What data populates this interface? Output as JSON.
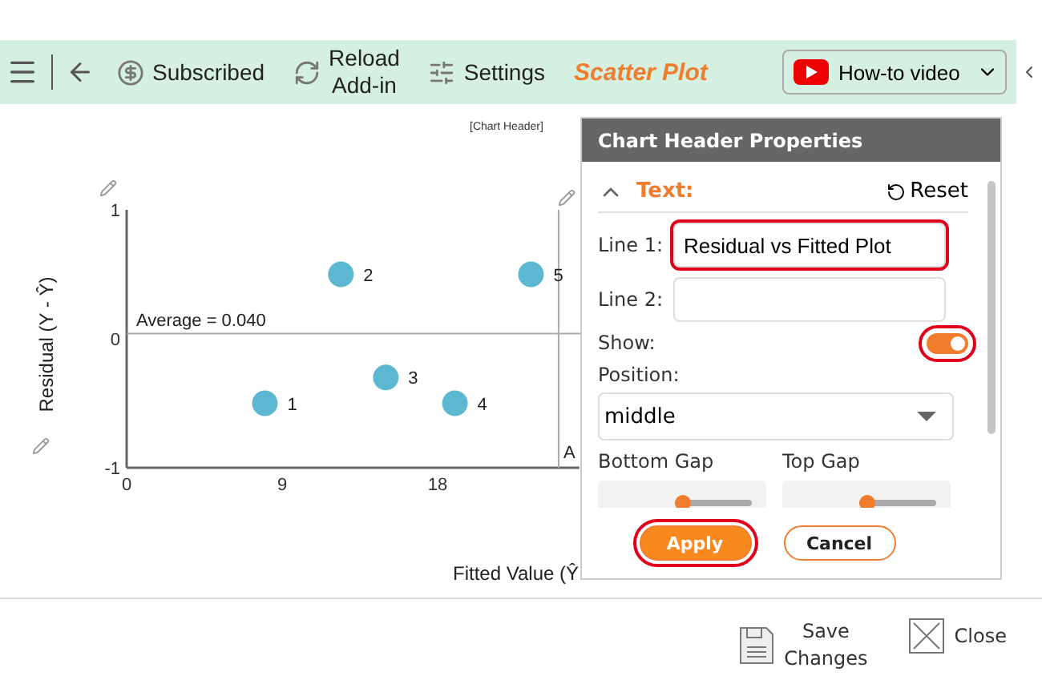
{
  "toolbar": {
    "subscribed": "Subscribed",
    "reload": [
      "Reload",
      "Add-in"
    ],
    "settings": "Settings",
    "title": "Scatter Plot",
    "video_button": "How-to video"
  },
  "chart": {
    "header": "[Chart Header]",
    "chart_data": {
      "type": "scatter",
      "xlabel": "Fitted Value (Ŷ",
      "ylabel": "Residual (Y - Ŷ)",
      "x": [
        8,
        12.4,
        15,
        19,
        23.4
      ],
      "series": [
        {
          "name": "1",
          "color": "#5bb8d0",
          "values": [
            -0.5,
            null,
            null,
            null,
            null
          ]
        },
        {
          "name": "2",
          "color": "#5bb8d0",
          "values": [
            null,
            0.5,
            null,
            null,
            null
          ]
        },
        {
          "name": "3",
          "color": "#5bb8d0",
          "values": [
            null,
            null,
            -0.3,
            null,
            null
          ]
        },
        {
          "name": "4",
          "color": "#5bb8d0",
          "values": [
            null,
            null,
            null,
            -0.5,
            null
          ]
        },
        {
          "name": "5",
          "color": "#5bb8d0",
          "values": [
            null,
            null,
            null,
            null,
            0.5
          ]
        }
      ],
      "xlim": [
        0,
        26.2
      ],
      "ylim": [
        -1,
        1
      ],
      "xticks": [
        0,
        9,
        18
      ],
      "yticks": [
        -1,
        0,
        1
      ],
      "ref_lines": [
        {
          "axis": "y",
          "value": 0.04
        },
        {
          "axis": "x",
          "value": 25
        }
      ],
      "annotations": [
        "Average = 0.040",
        "A"
      ]
    }
  },
  "panel": {
    "title": "Chart Header Properties",
    "section": {
      "label": "Text:",
      "expanded": true,
      "reset": "Reset"
    },
    "fields": [
      {
        "label": "Line 1:",
        "value": "Residual vs Fitted Plot",
        "highlighted": true
      },
      {
        "label": "Line 2:",
        "highlighted": false
      }
    ],
    "show": {
      "label": "Show:",
      "on": true,
      "highlighted": true
    },
    "position": {
      "label": "Position:",
      "value": "middle"
    },
    "gaps": [
      {
        "label": "Bottom Gap",
        "level": 0
      },
      {
        "label": "Top Gap",
        "level": 0
      }
    ],
    "buttons": [
      {
        "label": "Apply",
        "kind": "primary",
        "highlighted": true
      },
      {
        "label": "Cancel",
        "kind": "secondary",
        "highlighted": false
      }
    ]
  },
  "footer": {
    "save": [
      "Save",
      "Changes"
    ],
    "close": "Close"
  }
}
